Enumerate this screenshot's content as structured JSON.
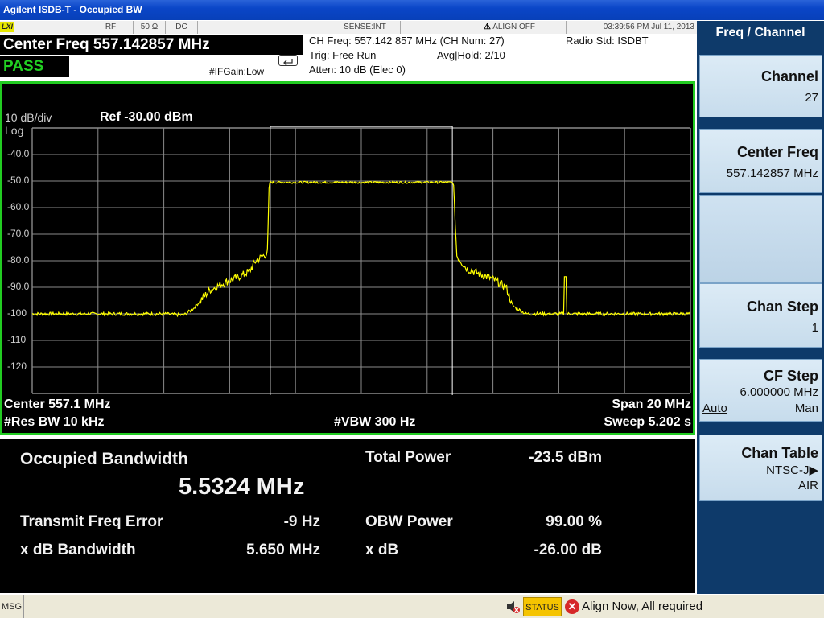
{
  "window": {
    "title": "Agilent ISDB-T - Occupied BW"
  },
  "status_row": {
    "lxi": "LXI",
    "rf": "RF",
    "impedance": "50 Ω",
    "coupling": "DC",
    "sense": "SENSE:INT",
    "align": "ALIGN OFF",
    "datetime": "03:39:56 PM Jul 11, 2013"
  },
  "header": {
    "center_freq": "Center Freq 557.142857 MHz",
    "pass": "PASS",
    "ifgain": "#IFGain:Low",
    "ch_freq": "CH Freq: 557.142 857 MHz (CH Num: 27)",
    "trig": "Trig: Free Run",
    "avg_hold": "Avg|Hold: 2/10",
    "atten": "Atten: 10 dB (Elec 0)",
    "radio_std": "Radio Std: ISDBT"
  },
  "plot": {
    "scale": "10 dB/div",
    "log": "Log",
    "ref": "Ref -30.00 dBm",
    "y_ticks": [
      "-40.0",
      "-50.0",
      "-60.0",
      "-70.0",
      "-80.0",
      "-90.0",
      "-100",
      "-110",
      "-120"
    ],
    "center": "Center  557.1 MHz",
    "res_bw": "#Res BW  10 kHz",
    "vbw": "#VBW  300 Hz",
    "span": "Span 20 MHz",
    "sweep": "Sweep  5.202 s",
    "trace_color": "#ffff00",
    "grid_color": "#8a8a8a",
    "frame_color": "#22cc22"
  },
  "chart_data": {
    "type": "line",
    "x_unit": "MHz offset from center",
    "xlim": [
      -10,
      10
    ],
    "ylim": [
      -130,
      -30
    ],
    "y_unit": "dBm",
    "obw_marker_left": -2.7662,
    "obw_marker_right": 2.7662,
    "series": [
      {
        "x": [
          -10,
          -6,
          -5.4,
          -5.1,
          -4.6,
          -4.1,
          -3.7,
          -3.4,
          -3.2,
          -2.85,
          -2.8,
          -2.6,
          0,
          2.6,
          2.8,
          2.9,
          3.2,
          3.6,
          4.0,
          4.4,
          4.6,
          5.0,
          5.5,
          6.0,
          7.5,
          10
        ],
        "y": [
          -100,
          -100,
          -100.5,
          -98,
          -91,
          -88,
          -86,
          -84,
          -80,
          -77,
          -50.5,
          -50.5,
          -50.5,
          -50.5,
          -50.5,
          -78,
          -83,
          -85,
          -87,
          -90,
          -97,
          -100,
          -100,
          -100,
          -100,
          -100
        ]
      }
    ],
    "spur": {
      "x": 6.2,
      "y": -86
    }
  },
  "results": {
    "obw_label": "Occupied Bandwidth",
    "obw_value": "5.5324 MHz",
    "tfe_label": "Transmit Freq Error",
    "tfe_value": "-9 Hz",
    "xdb_bw_label": "x dB Bandwidth",
    "xdb_bw_value": "5.650 MHz",
    "total_power_label": "Total Power",
    "total_power_value": "-23.5 dBm",
    "obw_power_label": "OBW Power",
    "obw_power_value": "99.00 %",
    "xdb_label": "x dB",
    "xdb_value": "-26.00 dB"
  },
  "menu": {
    "title": "Freq / Channel",
    "keys": [
      {
        "label": "Channel",
        "value": "27"
      },
      {
        "label": "Center Freq",
        "value": "557.142857 MHz"
      },
      {
        "label": "Chan Step",
        "value": "1"
      },
      {
        "label": "CF Step",
        "value": "6.000000 MHz",
        "auto": "Auto",
        "man": "Man"
      },
      {
        "label": "Chan Table",
        "value": "NTSC-J▶",
        "value2": "AIR"
      }
    ]
  },
  "bottom": {
    "msg": "MSG",
    "status": "STATUS",
    "align_msg": "Align Now, All required"
  }
}
